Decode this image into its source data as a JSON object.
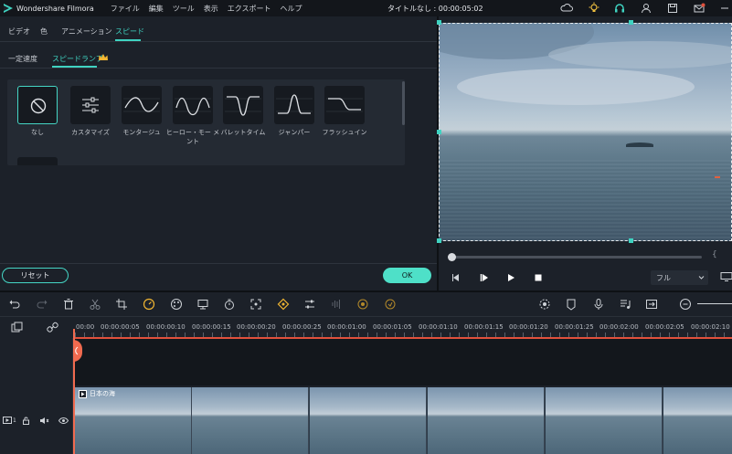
{
  "titlebar": {
    "app_name": "Wondershare Filmora",
    "menu": [
      "ファイル",
      "編集",
      "ツール",
      "表示",
      "エクスポート",
      "ヘルプ"
    ],
    "document_title": "タイトルなし : 00:00:05:02",
    "icons": [
      "cloud-icon",
      "lightbulb-icon",
      "headset-icon",
      "account-icon",
      "save-icon",
      "mail-icon",
      "minimize-icon"
    ]
  },
  "panel": {
    "tabs": [
      "ビデオ",
      "色",
      "アニメーション",
      "スピード"
    ],
    "active_tab": "スピード",
    "subtabs": [
      "一定速度",
      "スピードランプ"
    ],
    "active_subtab": "スピードランプ",
    "presets": [
      {
        "label": "なし",
        "icon": "none-icon",
        "selected": true
      },
      {
        "label": "カスタマイズ",
        "icon": "sliders-icon",
        "selected": false
      },
      {
        "label": "モンタージュ",
        "icon": "curve-montage-icon",
        "selected": false
      },
      {
        "label": "ヒーロー・モー メント",
        "icon": "curve-hero-icon",
        "selected": false
      },
      {
        "label": "バレットタイム",
        "icon": "curve-bullet-icon",
        "selected": false
      },
      {
        "label": "ジャンパー",
        "icon": "curve-jumper-icon",
        "selected": false
      },
      {
        "label": "フラッシュイン",
        "icon": "curve-flash-icon",
        "selected": false
      }
    ],
    "reset_label": "リセット",
    "ok_label": "OK"
  },
  "player": {
    "progress": 0.0,
    "zoom_label": "フル"
  },
  "timeline": {
    "ruler_labels": [
      "00:00",
      "00:00:00:05",
      "00:00:00:10",
      "00:00:00:15",
      "00:00:00:20",
      "00:00:00:25",
      "00:00:01:00",
      "00:00:01:05",
      "00:00:01:10",
      "00:00:01:15",
      "00:00:01:20",
      "00:00:01:25",
      "00:00:02:00",
      "00:00:02:05",
      "00:00:02:10"
    ],
    "clip_title": "日本の海",
    "track_number": "1"
  },
  "colors": {
    "accent": "#3fd3c1",
    "playhead": "#f06a4f",
    "background": "#1c2129"
  }
}
